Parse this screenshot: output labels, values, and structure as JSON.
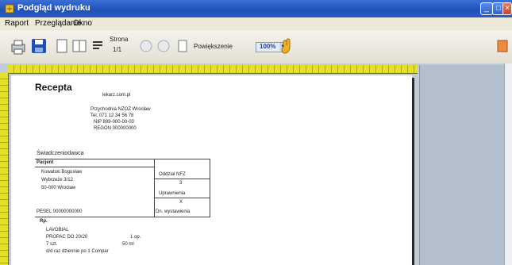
{
  "window": {
    "title": "Podgląd wydruku"
  },
  "menu": {
    "items": [
      "Raport",
      "Przeglądanie",
      "Okno"
    ]
  },
  "toolbar": {
    "strona_label": "Strona",
    "strona_value": "1/1",
    "zoom_label": "Powiększenie",
    "zoom_value": "100%"
  },
  "receipt": {
    "title": "Recepta",
    "header_line": "lekarz.com.pl",
    "address": [
      "Przychodnia NZOZ Wrocław",
      "Tel. 071 12 34 56 78",
      "NIP 899-000-00-00",
      "REGON 000000000"
    ],
    "patient_section": "Świadczeniodawca",
    "patient_label": "Pacjent",
    "patient_lines": [
      "Kowalski Bogusław",
      "Wybrzeże 3/12",
      "50-000 Wrocław"
    ],
    "pesel_line": "PESEL 00000000000",
    "right_cells": [
      "Oddział NFZ",
      "3",
      "Uprawnienia",
      "X",
      "Dn. wystawienia"
    ],
    "rp_label": "Rp.",
    "rx_lines": [
      "LAVOBIAL",
      "PROPAC DO 20/20",
      "7 szt.",
      "d/d raz dziennie po 1 Compar"
    ],
    "rx_right": [
      "1 op.",
      "50 ml"
    ]
  }
}
